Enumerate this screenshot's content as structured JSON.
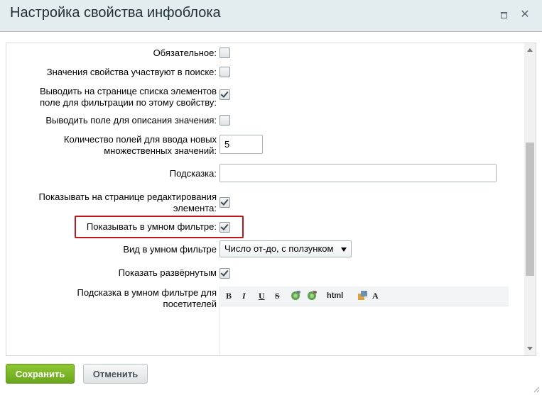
{
  "dialog": {
    "title": "Настройка свойства инфоблока",
    "maximize_icon": "maximize-icon",
    "close_icon": "close-icon",
    "close_glyph": "✕"
  },
  "form": {
    "required": {
      "label": "Обязательное:",
      "checked": false
    },
    "searchable": {
      "label": "Значения свойства участвуют в поиске:",
      "checked": false
    },
    "list_filter": {
      "label_line1": "Выводить на странице списка элементов",
      "label_line2": "поле для фильтрации по этому свойству:",
      "checked": true
    },
    "with_description": {
      "label": "Выводить поле для описания значения:",
      "checked": false
    },
    "multiple_cnt": {
      "label_line1": "Количество полей для ввода новых",
      "label_line2": "множественных значений:",
      "value": "5"
    },
    "hint": {
      "label": "Подсказка:",
      "value": ""
    },
    "show_on_edit": {
      "label_line1": "Показывать на странице редактирования",
      "label_line2": "элемента:",
      "checked": true
    },
    "smart_filter": {
      "label": "Показывать в умном фильтре:",
      "checked": true
    },
    "smart_filter_view": {
      "label": "Вид в умном фильтре",
      "selected": "Число от-до, с ползунком"
    },
    "show_expanded": {
      "label": "Показать развёрнутым",
      "checked": true
    },
    "filter_hint": {
      "label_line1": "Подсказка в умном фильтре для",
      "label_line2": "посетителей",
      "toolbar": {
        "bold": "B",
        "italic": "I",
        "underline": "U",
        "strike": "S",
        "html": "html",
        "font": "A"
      }
    }
  },
  "footer": {
    "save_label": "Сохранить",
    "cancel_label": "Отменить"
  },
  "colors": {
    "header_bg": "#e3ecef",
    "save_green": "#7ab628",
    "highlight_red": "#c0161b"
  }
}
